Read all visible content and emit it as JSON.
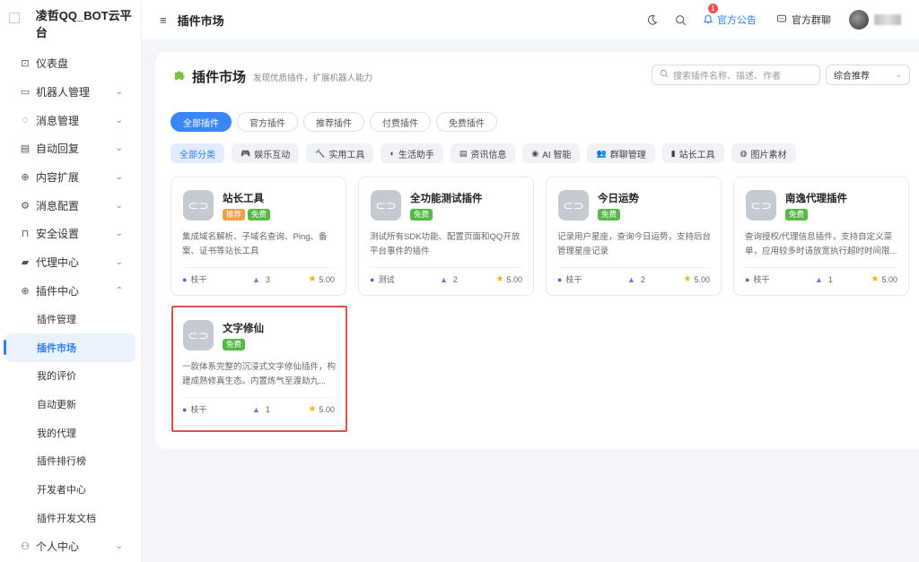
{
  "brand": {
    "title": "凌哲QQ_BOT云平台"
  },
  "sidebar": {
    "items": [
      {
        "label": "仪表盘",
        "icon": "dashboard-icon",
        "glyph": "⊡",
        "chevron": ""
      },
      {
        "label": "机器人管理",
        "icon": "monitor-icon",
        "glyph": "▭",
        "chevron": "⌄"
      },
      {
        "label": "消息管理",
        "icon": "chat-icon",
        "glyph": "◌",
        "chevron": "⌄"
      },
      {
        "label": "自动回复",
        "icon": "message-square-icon",
        "glyph": "▤",
        "chevron": "⌄"
      },
      {
        "label": "内容扩展",
        "icon": "extension-icon",
        "glyph": "⊕",
        "chevron": "⌄"
      },
      {
        "label": "消息配置",
        "icon": "gear-icon",
        "glyph": "⚙",
        "chevron": "⌄"
      },
      {
        "label": "安全设置",
        "icon": "lock-icon",
        "glyph": "⊓",
        "chevron": "⌄"
      },
      {
        "label": "代理中心",
        "icon": "proxy-icon",
        "glyph": "▰",
        "chevron": "⌄"
      },
      {
        "label": "插件中心",
        "icon": "plugin-icon",
        "glyph": "⊕",
        "chevron": "⌃"
      }
    ],
    "subitems": [
      {
        "label": "插件管理",
        "active": false
      },
      {
        "label": "插件市场",
        "active": true
      },
      {
        "label": "我的评价",
        "active": false
      },
      {
        "label": "自动更新",
        "active": false
      },
      {
        "label": "我的代理",
        "active": false
      },
      {
        "label": "插件排行榜",
        "active": false
      },
      {
        "label": "开发者中心",
        "active": false
      },
      {
        "label": "插件开发文档",
        "active": false
      }
    ],
    "bottom": {
      "label": "个人中心",
      "icon": "user-icon",
      "glyph": "⚇",
      "chevron": "⌄"
    }
  },
  "header": {
    "title": "插件市场",
    "notice_label": "官方公告",
    "notice_count": "1",
    "group_label": "官方群聊"
  },
  "panel": {
    "title": "插件市场",
    "subtitle": "发现优质插件，扩展机器人能力",
    "search_placeholder": "搜索插件名称、描述、作者",
    "sort_value": "综合推荐"
  },
  "tabs": [
    "全部插件",
    "官方插件",
    "推荐插件",
    "付费插件",
    "免费插件"
  ],
  "categories": [
    {
      "label": "全部分类",
      "glyph": ""
    },
    {
      "label": "娱乐互动",
      "glyph": "🎮"
    },
    {
      "label": "实用工具",
      "glyph": "🔨"
    },
    {
      "label": "生活助手",
      "glyph": "◐"
    },
    {
      "label": "资讯信息",
      "glyph": "▤"
    },
    {
      "label": "AI 智能",
      "glyph": "◉"
    },
    {
      "label": "群聊管理",
      "glyph": "👥"
    },
    {
      "label": "站长工具",
      "glyph": "▮"
    },
    {
      "label": "图片素材",
      "glyph": "◍"
    }
  ],
  "plugins": [
    {
      "name": "站长工具",
      "tags": [
        "推荐",
        "免费"
      ],
      "desc": "集成域名解析、子域名查询、Ping、备案、证书等站长工具",
      "author": "枝干",
      "installs": "3",
      "rating": "5.00"
    },
    {
      "name": "全功能测试插件",
      "tags": [
        "免费"
      ],
      "desc": "测试所有SDK功能、配置页面和QQ开放平台事件的插件",
      "author": "测试",
      "installs": "2",
      "rating": "5.00"
    },
    {
      "name": "今日运势",
      "tags": [
        "免费"
      ],
      "desc": "记录用户星座，查询今日运势，支持后台管理星座记录",
      "author": "枝干",
      "installs": "2",
      "rating": "5.00"
    },
    {
      "name": "南逸代理插件",
      "tags": [
        "免费"
      ],
      "desc": "查询授权/代理信息插件，支持自定义菜单，应用较多时请放宽执行超时时间限...",
      "author": "枝干",
      "installs": "1",
      "rating": "5.00"
    },
    {
      "name": "文字修仙",
      "tags": [
        "免费"
      ],
      "desc": "一款体系完整的沉浸式文字修仙插件，构建成熟修真生态。内置炼气至渡劫九...",
      "author": "枝干",
      "installs": "1",
      "rating": "5.00"
    }
  ],
  "colors": {
    "accent": "#3b86f7",
    "free": "#56b847",
    "recommend": "#f0a040",
    "highlight": "#e84d4d"
  }
}
